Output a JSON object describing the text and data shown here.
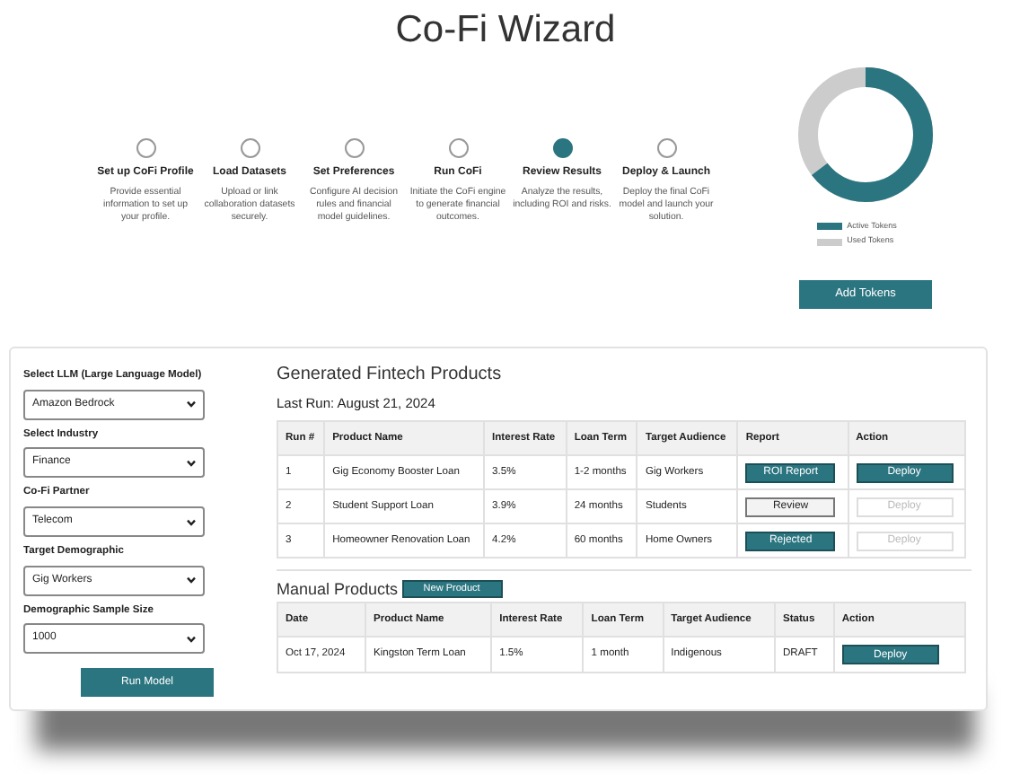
{
  "title": "Co-Fi Wizard",
  "steps": [
    {
      "label": "Set up CoFi Profile",
      "description": "Provide essential information to set up your profile.",
      "selected": false
    },
    {
      "label": "Load Datasets",
      "description": "Upload or link collaboration datasets securely.",
      "selected": false
    },
    {
      "label": "Set Preferences",
      "description": "Configure AI decision rules and financial model guidelines.",
      "selected": false
    },
    {
      "label": "Run CoFi",
      "description": "Initiate the CoFi engine to generate financial outcomes.",
      "selected": false
    },
    {
      "label": "Review Results",
      "description": "Analyze the results, including ROI and risks.",
      "selected": true
    },
    {
      "label": "Deploy & Launch",
      "description": "Deploy the final CoFi model and launch your solution.",
      "selected": false
    }
  ],
  "tokens": {
    "legend": [
      {
        "label": "Active Tokens",
        "color": "#2b7580"
      },
      {
        "label": "Used Tokens",
        "color": "#cccccc"
      }
    ],
    "button": "Add Tokens"
  },
  "form": {
    "fields": [
      {
        "label": "Select LLM (Large Language Model)",
        "value": "Amazon Bedrock"
      },
      {
        "label": "Select Industry",
        "value": "Finance"
      },
      {
        "label": "Co-Fi Partner",
        "value": "Telecom"
      },
      {
        "label": "Target Demographic",
        "value": "Gig Workers"
      },
      {
        "label": "Demographic Sample Size",
        "value": "1000"
      }
    ],
    "button": "Run Model"
  },
  "generated": {
    "title": "Generated Fintech Products",
    "last_run": "Last Run: August 21, 2024",
    "columns": [
      "Run #",
      "Product Name",
      "Interest Rate",
      "Loan Term",
      "Target Audience",
      "Report",
      "Action"
    ],
    "rows": [
      {
        "cells": [
          "1",
          "Gig Economy Booster Loan",
          "3.5%",
          "1-2 months",
          "Gig Workers"
        ],
        "report": {
          "label": "ROI Report",
          "kind": "primary"
        },
        "action": {
          "label": "Deploy",
          "disabled": false
        }
      },
      {
        "cells": [
          "2",
          "Student Support Loan",
          "3.9%",
          "24 months",
          "Students"
        ],
        "report": {
          "label": "Review",
          "kind": "secondary"
        },
        "action": {
          "label": "Deploy",
          "disabled": true
        }
      },
      {
        "cells": [
          "3",
          "Homeowner Renovation Loan",
          "4.2%",
          "60 months",
          "Home Owners"
        ],
        "report": {
          "label": "Rejected",
          "kind": "primary"
        },
        "action": {
          "label": "Deploy",
          "disabled": true
        }
      }
    ]
  },
  "manual": {
    "title": "Manual Products",
    "button": "New Product",
    "columns": [
      "Date",
      "Product Name",
      "Interest Rate",
      "Loan Term",
      "Target Audience",
      "Status",
      "Action"
    ],
    "rows": [
      {
        "cells": [
          "Oct 17, 2024",
          "Kingston Term Loan",
          "1.5%",
          "1 month",
          "Indigenous",
          "DRAFT"
        ],
        "action": {
          "label": "Deploy",
          "disabled": false
        }
      }
    ]
  }
}
